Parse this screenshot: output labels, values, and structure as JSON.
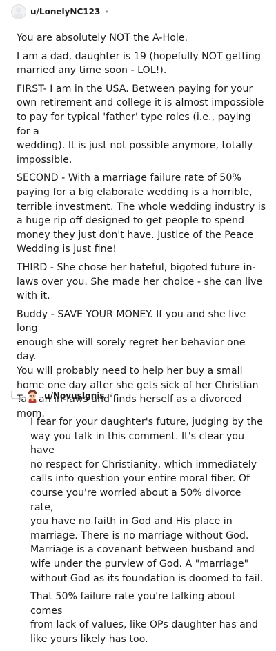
{
  "comment1": {
    "username": "u/LonelyNC123",
    "separator": "•",
    "paragraphs": [
      "You are absolutely NOT the A-Hole.",
      "I am a dad, daughter is 19 (hopefully NOT getting\nmarried any time soon - LOL!).",
      "FIRST- I am in the USA. Between paying for your\nown retirement and college it is almost impossible\nto pay for typical 'father' type roles (i.e., paying for a\nwedding). It is just not possible anymore, totally\nimpossible.",
      "SECOND - With a marriage failure rate of 50%\npaying for a big elaborate wedding is a horrible,\nterrible investment. The whole wedding industry is\na huge rip off designed to get people to spend\nmoney they just don't have. Justice of the Peace\nWedding is just fine!",
      "THIRD - She chose her hateful, bigoted future in-\nlaws over you. She made her choice - she can live\nwith it.",
      "Buddy - SAVE YOUR MONEY. If you and she live long\nenough she will sorely regret her behavior one day.\nYou will probably need to help her buy a small\nhome one day after she gets sick of her Christian\nTaliban in-laws and finds herself as a divorced mom."
    ]
  },
  "comment2": {
    "username": "u/NovusIgnis",
    "separator": "•",
    "paragraphs": [
      "I fear for your daughter's future, judging by the\nway you talk in this comment. It's clear you have\nno respect for Christianity, which immediately\ncalls into question your entire moral fiber. Of\ncourse you're worried about a 50% divorce rate,\nyou have no faith in God and His place in\nmarriage. There is no marriage without God.\nMarriage is a covenant between husband and\nwife under the purview of God. A \"marriage\"\nwithout God as its foundation is doomed to fail.",
      "That 50% failure rate you're talking about comes\nfrom lack of values, like OPs daughter has and\nlike yours likely has too."
    ]
  }
}
